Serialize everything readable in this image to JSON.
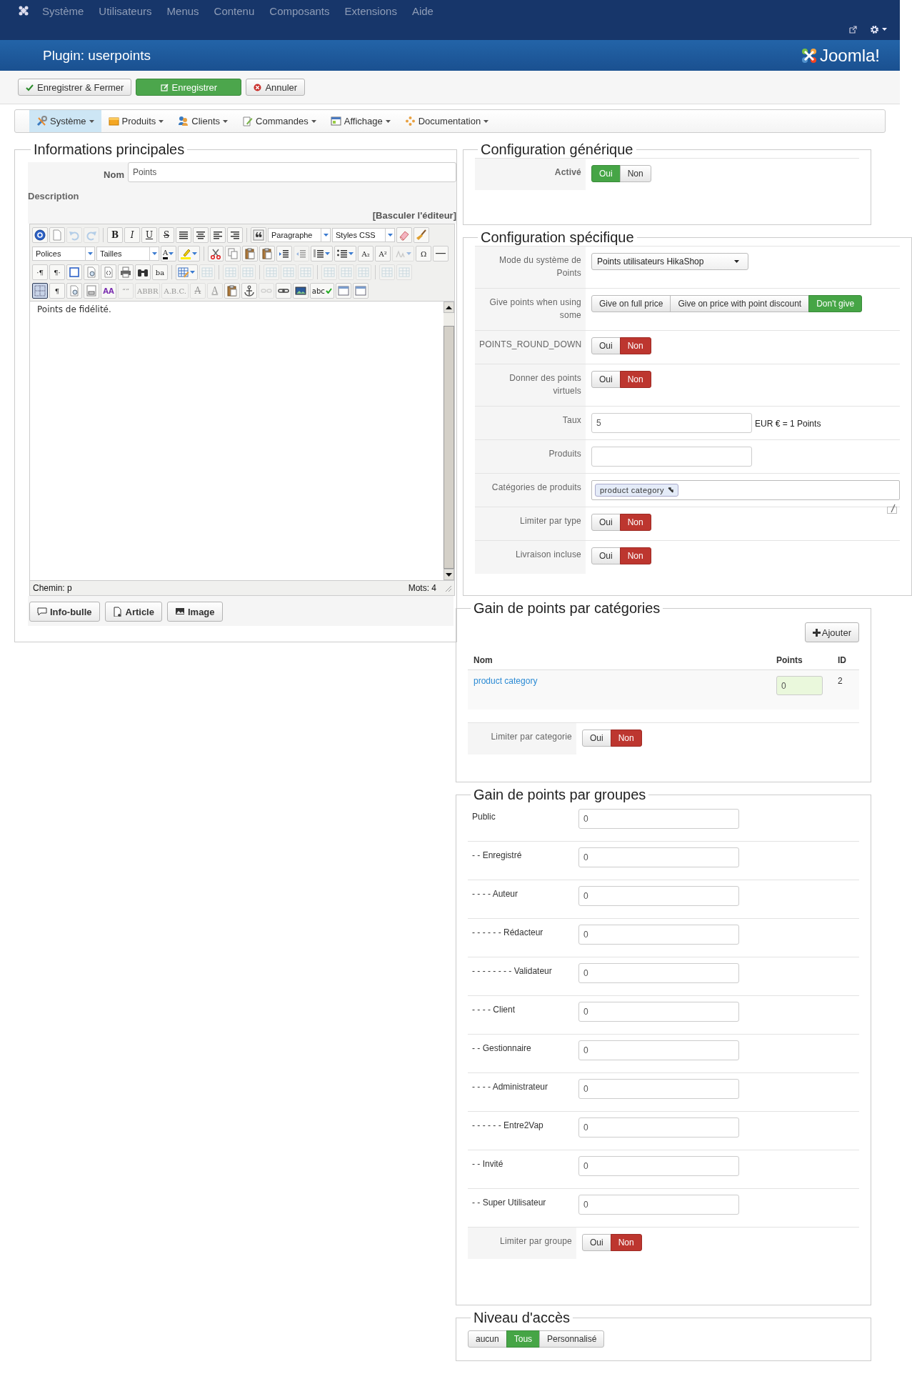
{
  "topnav": {
    "menus": [
      "Système",
      "Utilisateurs",
      "Menus",
      "Contenu",
      "Composants",
      "Extensions",
      "Aide"
    ]
  },
  "header": {
    "title": "Plugin: userpoints",
    "brand": "Joomla!"
  },
  "actions": [
    {
      "label": "Enregistrer & Fermer",
      "kind": "save-close"
    },
    {
      "label": "Enregistrer",
      "kind": "save"
    },
    {
      "label": "Annuler",
      "kind": "cancel"
    }
  ],
  "shop_menu": [
    {
      "label": "Système",
      "kind": "tools",
      "selected": true
    },
    {
      "label": "Produits",
      "kind": "products",
      "selected": false
    },
    {
      "label": "Clients",
      "kind": "customers",
      "selected": false
    },
    {
      "label": "Commandes",
      "kind": "orders",
      "selected": false
    },
    {
      "label": "Affichage",
      "kind": "display",
      "selected": false
    },
    {
      "label": "Documentation",
      "kind": "docs",
      "selected": false
    }
  ],
  "main_info": {
    "legend": "Informations principales",
    "name_label": "Nom",
    "name_value": "Points",
    "description_label": "Description",
    "toggle_editor": "[Basculer l'éditeur]",
    "editor": {
      "toolbar_rows": [
        [
          [
            {
              "kind": "help",
              "disabled": false,
              "pressed": false
            },
            {
              "kind": "page",
              "disabled": false,
              "pressed": false
            },
            {
              "kind": "undo",
              "disabled": true,
              "pressed": false
            },
            {
              "kind": "redo",
              "disabled": true,
              "pressed": false
            }
          ],
          [
            {
              "kind": "bold",
              "text": "B",
              "disabled": false,
              "pressed": false
            },
            {
              "kind": "italic",
              "text": "I",
              "disabled": false,
              "pressed": false
            },
            {
              "kind": "underline",
              "text": "U",
              "disabled": false,
              "pressed": false
            },
            {
              "kind": "strike",
              "text": "S",
              "disabled": false,
              "pressed": false
            },
            {
              "kind": "justify",
              "disabled": false,
              "pressed": false
            },
            {
              "kind": "center",
              "disabled": false,
              "pressed": false
            },
            {
              "kind": "left",
              "disabled": false,
              "pressed": false
            },
            {
              "kind": "right",
              "disabled": false,
              "pressed": false
            }
          ],
          [
            {
              "kind": "quote",
              "disabled": false,
              "pressed": false
            },
            {
              "kind": "select",
              "text": "Paragraphe"
            },
            {
              "kind": "select",
              "text": "Styles CSS"
            },
            {
              "kind": "eraser",
              "disabled": false,
              "pressed": false
            },
            {
              "kind": "broom",
              "disabled": false,
              "pressed": false
            }
          ]
        ],
        [
          [
            {
              "kind": "select",
              "text": "Polices"
            },
            {
              "kind": "select",
              "text": "Tailles"
            },
            {
              "kind": "textcolor",
              "text": "A",
              "disabled": false,
              "pressed": false
            },
            {
              "kind": "highlight",
              "disabled": false,
              "pressed": false
            }
          ],
          [
            {
              "kind": "cut",
              "disabled": false,
              "pressed": false
            },
            {
              "kind": "copy",
              "disabled": false,
              "pressed": false
            },
            {
              "kind": "paste",
              "disabled": false,
              "pressed": false
            },
            {
              "kind": "paste",
              "disabled": false,
              "pressed": false
            },
            {
              "kind": "indent",
              "disabled": false,
              "pressed": false
            },
            {
              "kind": "outdent",
              "disabled": true,
              "pressed": false
            },
            {
              "kind": "numlist",
              "disabled": false,
              "pressed": false
            },
            {
              "kind": "bullist",
              "disabled": false,
              "pressed": false
            },
            {
              "kind": "glyph",
              "text": "A₂",
              "disabled": false,
              "pressed": false
            },
            {
              "kind": "glyph",
              "text": "A²",
              "disabled": false,
              "pressed": false
            },
            {
              "kind": "lang",
              "disabled": true,
              "pressed": false
            },
            {
              "kind": "glyph",
              "text": "Ω",
              "disabled": false,
              "pressed": false
            },
            {
              "kind": "hr",
              "disabled": false,
              "pressed": false
            }
          ]
        ],
        [
          [
            {
              "kind": "glyph",
              "text": "·¶",
              "disabled": false,
              "pressed": false
            },
            {
              "kind": "glyph",
              "text": "¶·",
              "disabled": false,
              "pressed": false
            },
            {
              "kind": "fullscreen",
              "disabled": false,
              "pressed": false
            },
            {
              "kind": "preview",
              "disabled": false,
              "pressed": false
            },
            {
              "kind": "code",
              "disabled": false,
              "pressed": false
            },
            {
              "kind": "print",
              "disabled": false,
              "pressed": false
            },
            {
              "kind": "find",
              "disabled": false,
              "pressed": false
            },
            {
              "kind": "glyph",
              "text": "ba",
              "disabled": false,
              "pressed": false
            }
          ],
          [
            {
              "kind": "table",
              "disabled": false,
              "pressed": false
            },
            {
              "kind": "grid",
              "disabled": true,
              "pressed": false
            }
          ],
          [
            {
              "kind": "grid",
              "disabled": true,
              "pressed": false
            },
            {
              "kind": "grid",
              "disabled": true,
              "pressed": false
            }
          ],
          [
            {
              "kind": "grid",
              "disabled": true,
              "pressed": false
            },
            {
              "kind": "grid",
              "disabled": true,
              "pressed": false
            },
            {
              "kind": "grid",
              "disabled": true,
              "pressed": false
            }
          ],
          [
            {
              "kind": "grid",
              "disabled": true,
              "pressed": false
            },
            {
              "kind": "grid",
              "disabled": true,
              "pressed": false
            },
            {
              "kind": "grid",
              "disabled": true,
              "pressed": false
            }
          ],
          [
            {
              "kind": "grid",
              "disabled": true,
              "pressed": false
            },
            {
              "kind": "grid",
              "disabled": true,
              "pressed": false
            }
          ]
        ],
        [
          [
            {
              "kind": "visualaid",
              "disabled": false,
              "pressed": true
            },
            {
              "kind": "glyph",
              "text": "¶",
              "disabled": false,
              "pressed": false
            },
            {
              "kind": "preview",
              "disabled": false,
              "pressed": false
            },
            {
              "kind": "template",
              "disabled": false,
              "pressed": false
            },
            {
              "kind": "style",
              "text": "AA",
              "disabled": false,
              "pressed": false
            },
            {
              "kind": "glyph",
              "text": "“”",
              "disabled": true,
              "pressed": false
            },
            {
              "kind": "glyph",
              "text": "ABBR",
              "disabled": true,
              "pressed": false
            },
            {
              "kind": "glyph",
              "text": "A.B.C.",
              "disabled": true,
              "pressed": false
            },
            {
              "kind": "strike",
              "text": "A",
              "disabled": true,
              "pressed": false
            },
            {
              "kind": "underline",
              "text": "A",
              "disabled": true,
              "pressed": false
            },
            {
              "kind": "paste",
              "disabled": false,
              "pressed": false
            },
            {
              "kind": "anchor",
              "disabled": false,
              "pressed": false
            },
            {
              "kind": "unlink",
              "disabled": true,
              "pressed": false
            },
            {
              "kind": "link",
              "disabled": false,
              "pressed": false
            },
            {
              "kind": "image",
              "disabled": false,
              "pressed": false
            },
            {
              "kind": "spell",
              "text": "abc",
              "disabled": false,
              "pressed": false
            },
            {
              "kind": "layer",
              "disabled": false,
              "pressed": false
            },
            {
              "kind": "layer",
              "disabled": false,
              "pressed": false
            }
          ]
        ]
      ],
      "content": "Points de fidélité.",
      "path": "Chemin: p",
      "words": "Mots: 4"
    },
    "buttons": [
      {
        "label": "Info-bulle",
        "kind": "tooltip"
      },
      {
        "label": "Article",
        "kind": "article"
      },
      {
        "label": "Image",
        "kind": "image"
      }
    ]
  },
  "generic_config": {
    "legend": "Configuration générique",
    "rows": [
      {
        "label": "Activé",
        "kind": "toggle",
        "options": [
          {
            "label": "Oui",
            "selected": true
          },
          {
            "label": "Non",
            "selected": false
          }
        ]
      }
    ]
  },
  "specific_config": {
    "legend": "Configuration spécifique",
    "rows": [
      {
        "label": "Mode du système de Points",
        "kind": "select",
        "value": "Points utilisateurs HikaShop"
      },
      {
        "label": "Give points when using some",
        "kind": "toggle",
        "options": [
          {
            "label": "Give on full price",
            "selected": false
          },
          {
            "label": "Give on price with point discount",
            "selected": false
          },
          {
            "label": "Don't give",
            "selected": true
          }
        ]
      },
      {
        "label": "POINTS_ROUND_DOWN",
        "kind": "toggle",
        "options": [
          {
            "label": "Oui",
            "selected": false
          },
          {
            "label": "Non",
            "selected": true
          }
        ]
      },
      {
        "label": "Donner des points virtuels",
        "kind": "toggle",
        "options": [
          {
            "label": "Oui",
            "selected": false
          },
          {
            "label": "Non",
            "selected": true
          }
        ]
      },
      {
        "label": "Taux",
        "kind": "rate",
        "value": "5",
        "suffix": "EUR € = 1 Points"
      },
      {
        "label": "Produits",
        "kind": "text"
      },
      {
        "label": "Catégories de produits",
        "kind": "tags",
        "tags": [
          "product category"
        ]
      },
      {
        "label": "Limiter par type",
        "kind": "toggle",
        "options": [
          {
            "label": "Oui",
            "selected": false
          },
          {
            "label": "Non",
            "selected": true
          }
        ]
      },
      {
        "label": "Livraison incluse",
        "kind": "toggle",
        "options": [
          {
            "label": "Oui",
            "selected": false
          },
          {
            "label": "Non",
            "selected": true
          }
        ]
      }
    ]
  },
  "category_points": {
    "legend": "Gain de points par catégories",
    "add_button": "Ajouter",
    "columns": [
      "Nom",
      "Points",
      "ID"
    ],
    "rows": [
      {
        "name": "product category",
        "points": "0",
        "id": "2"
      }
    ],
    "limit": {
      "label": "Limiter par categorie",
      "options": [
        {
          "label": "Oui",
          "selected": false
        },
        {
          "label": "Non",
          "selected": true
        }
      ]
    }
  },
  "group_points": {
    "legend": "Gain de points par groupes",
    "rows": [
      {
        "label": "Public",
        "value": "0"
      },
      {
        "label": "- - Enregistré",
        "value": "0"
      },
      {
        "label": "- - - - Auteur",
        "value": "0"
      },
      {
        "label": "- - - - - - Rédacteur",
        "value": "0"
      },
      {
        "label": "- - - - - - - - Validateur",
        "value": "0"
      },
      {
        "label": "- - - - Client",
        "value": "0"
      },
      {
        "label": "- - Gestionnaire",
        "value": "0"
      },
      {
        "label": "- - - - Administrateur",
        "value": "0"
      },
      {
        "label": "- - - - - - Entre2Vap",
        "value": "0"
      },
      {
        "label": "- - Invité",
        "value": "0"
      },
      {
        "label": "- - Super Utilisateur",
        "value": "0"
      }
    ],
    "limit": {
      "label": "Limiter par groupe",
      "options": [
        {
          "label": "Oui",
          "selected": false
        },
        {
          "label": "Non",
          "selected": true
        }
      ]
    }
  },
  "access_level": {
    "legend": "Niveau d'accès",
    "options": [
      {
        "label": "aucun",
        "selected": false
      },
      {
        "label": "Tous",
        "selected": true
      },
      {
        "label": "Personnalisé",
        "selected": false
      }
    ]
  }
}
